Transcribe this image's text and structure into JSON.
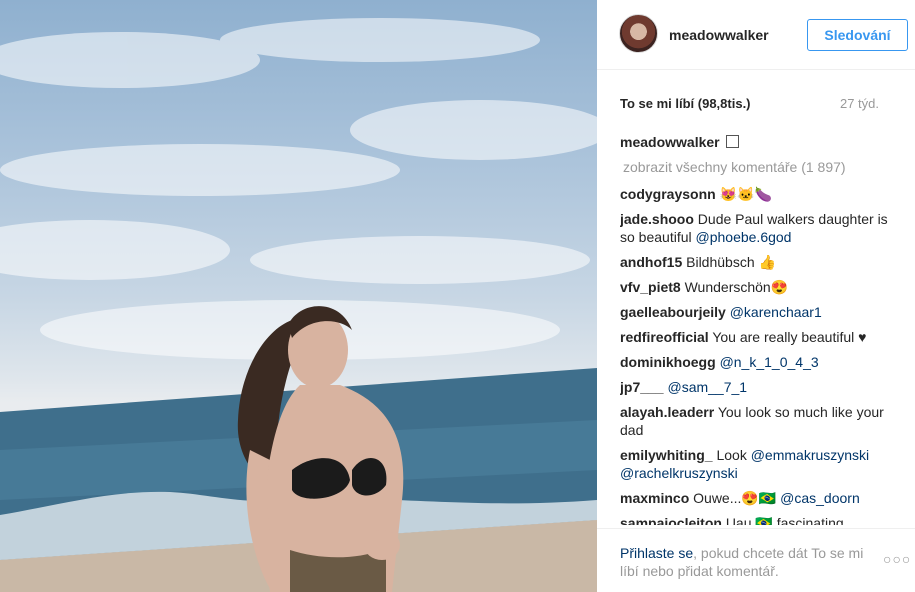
{
  "post": {
    "username": "meadowwalker",
    "follow_label": "Sledování",
    "likes": "To se mi líbí (98,8tis.)",
    "time_ago": "27 týd.",
    "caption_user": "meadowwalker",
    "caption_text": "🇱🇷",
    "view_all": "zobrazit všechny komentáře (1 897)"
  },
  "comments": [
    {
      "user": "codygraysonn",
      "text": "😻🐱🍆",
      "mention": ""
    },
    {
      "user": "jade.shooo",
      "text": "Dude Paul walkers daughter is so beautiful",
      "mention": "@phoebe.6god"
    },
    {
      "user": "andhof15",
      "text": "Bildhübsch 👍",
      "mention": ""
    },
    {
      "user": "vfv_piet8",
      "text": "Wunderschön😍",
      "mention": ""
    },
    {
      "user": "gaelleabourjeily",
      "text": "",
      "mention": "@karenchaar1"
    },
    {
      "user": "redfireofficial",
      "text": "You are really beautiful ♥",
      "mention": ""
    },
    {
      "user": "dominikhoegg",
      "text": "",
      "mention": "@n_k_1_0_4_3"
    },
    {
      "user": "jp7___",
      "text": "",
      "mention": "@sam__7_1"
    },
    {
      "user": "alayah.leaderr",
      "text": "You look so much like your dad",
      "mention": ""
    },
    {
      "user": "emilywhiting_",
      "text": "Look",
      "mention": "@emmakruszynski @rachelkruszynski"
    },
    {
      "user": "maxminco",
      "text": "Ouwe...😍🇧🇷",
      "mention": "@cas_doorn"
    },
    {
      "user": "sampaiocleiton",
      "text": "Uau 🇧🇷 fascinating",
      "mention": ""
    }
  ],
  "footer": {
    "login_link": "Přihlaste se",
    "login_rest": ", pokud chcete dát To se mi líbí nebo přidat komentář.",
    "more": "○○○"
  }
}
